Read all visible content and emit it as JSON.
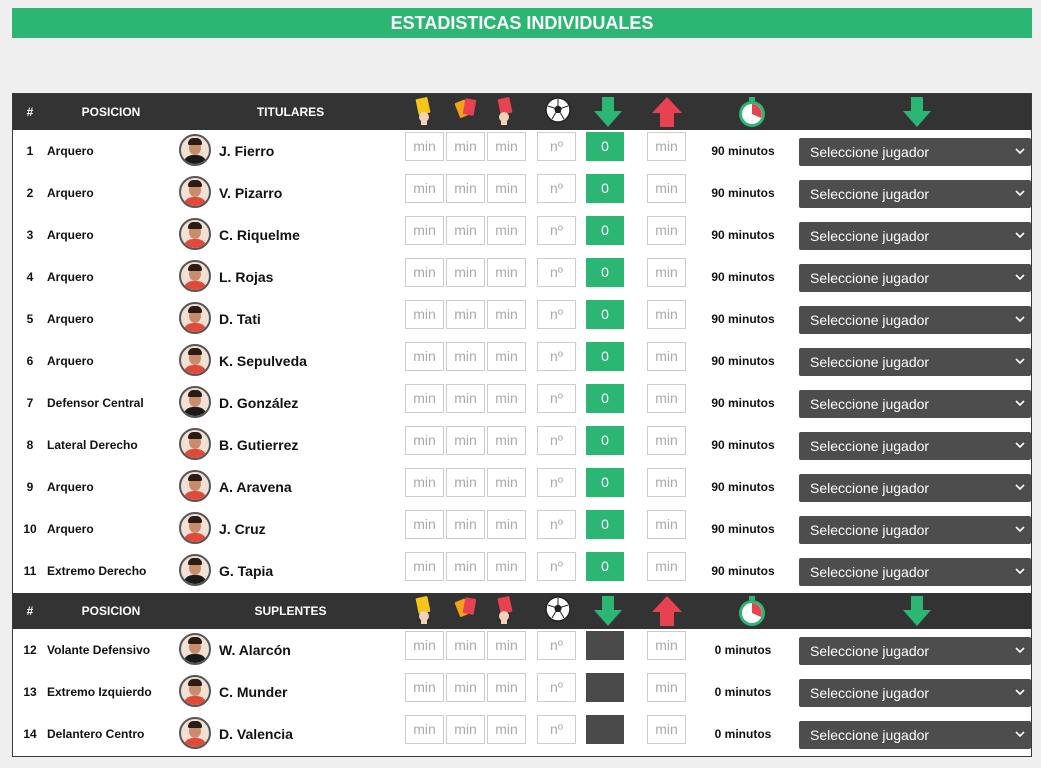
{
  "title": "ESTADISTICAS INDIVIDUALES",
  "headers": {
    "num": "#",
    "posicion": "POSICION",
    "titulares": "TITULARES",
    "suplentes": "SUPLENTES"
  },
  "placeholders": {
    "min": "min",
    "num": "nº"
  },
  "select_placeholder": "Seleccione jugador",
  "icons": [
    "yellow-card-icon",
    "second-yellow-card-icon",
    "red-card-icon",
    "ball-icon",
    "sub-out-arrow-icon",
    "sub-in-arrow-icon",
    "stopwatch-icon",
    "replacement-arrow-icon"
  ],
  "colors": {
    "green": "#2bb673",
    "red_arrow": "#e8414f",
    "header": "#333333"
  },
  "titulares": [
    {
      "num": "1",
      "pos": "Arquero",
      "name": "J. Fierro",
      "count": "0",
      "minutes": "90 minutos",
      "shirt": "#1a1a1a"
    },
    {
      "num": "2",
      "pos": "Arquero",
      "name": "V. Pizarro",
      "count": "0",
      "minutes": "90 minutos",
      "shirt": "#e04a3a"
    },
    {
      "num": "3",
      "pos": "Arquero",
      "name": "C. Riquelme",
      "count": "0",
      "minutes": "90 minutos",
      "shirt": "#e04a3a"
    },
    {
      "num": "4",
      "pos": "Arquero",
      "name": "L. Rojas",
      "count": "0",
      "minutes": "90 minutos",
      "shirt": "#e04a3a"
    },
    {
      "num": "5",
      "pos": "Arquero",
      "name": "D. Tati",
      "count": "0",
      "minutes": "90 minutos",
      "shirt": "#e04a3a"
    },
    {
      "num": "6",
      "pos": "Arquero",
      "name": "K. Sepulveda",
      "count": "0",
      "minutes": "90 minutos",
      "shirt": "#e04a3a"
    },
    {
      "num": "7",
      "pos": "Defensor Central",
      "name": "D. González",
      "count": "0",
      "minutes": "90 minutos",
      "shirt": "#1a1a1a"
    },
    {
      "num": "8",
      "pos": "Lateral Derecho",
      "name": "B. Gutierrez",
      "count": "0",
      "minutes": "90 minutos",
      "shirt": "#e04a3a"
    },
    {
      "num": "9",
      "pos": "Arquero",
      "name": "A. Aravena",
      "count": "0",
      "minutes": "90 minutos",
      "shirt": "#e04a3a"
    },
    {
      "num": "10",
      "pos": "Arquero",
      "name": "J. Cruz",
      "count": "0",
      "minutes": "90 minutos",
      "shirt": "#e04a3a"
    },
    {
      "num": "11",
      "pos": "Extremo Derecho",
      "name": "G. Tapia",
      "count": "0",
      "minutes": "90 minutos",
      "shirt": "#1a1a1a"
    }
  ],
  "suplentes": [
    {
      "num": "12",
      "pos": "Volante Defensivo",
      "name": "W. Alarcón",
      "minutes": "0 minutos",
      "shirt": "#1a1a1a"
    },
    {
      "num": "13",
      "pos": "Extremo Izquierdo",
      "name": "C. Munder",
      "minutes": "0 minutos",
      "shirt": "#e04a3a"
    },
    {
      "num": "14",
      "pos": "Delantero Centro",
      "name": "D. Valencia",
      "minutes": "0 minutos",
      "shirt": "#e04a3a"
    }
  ]
}
